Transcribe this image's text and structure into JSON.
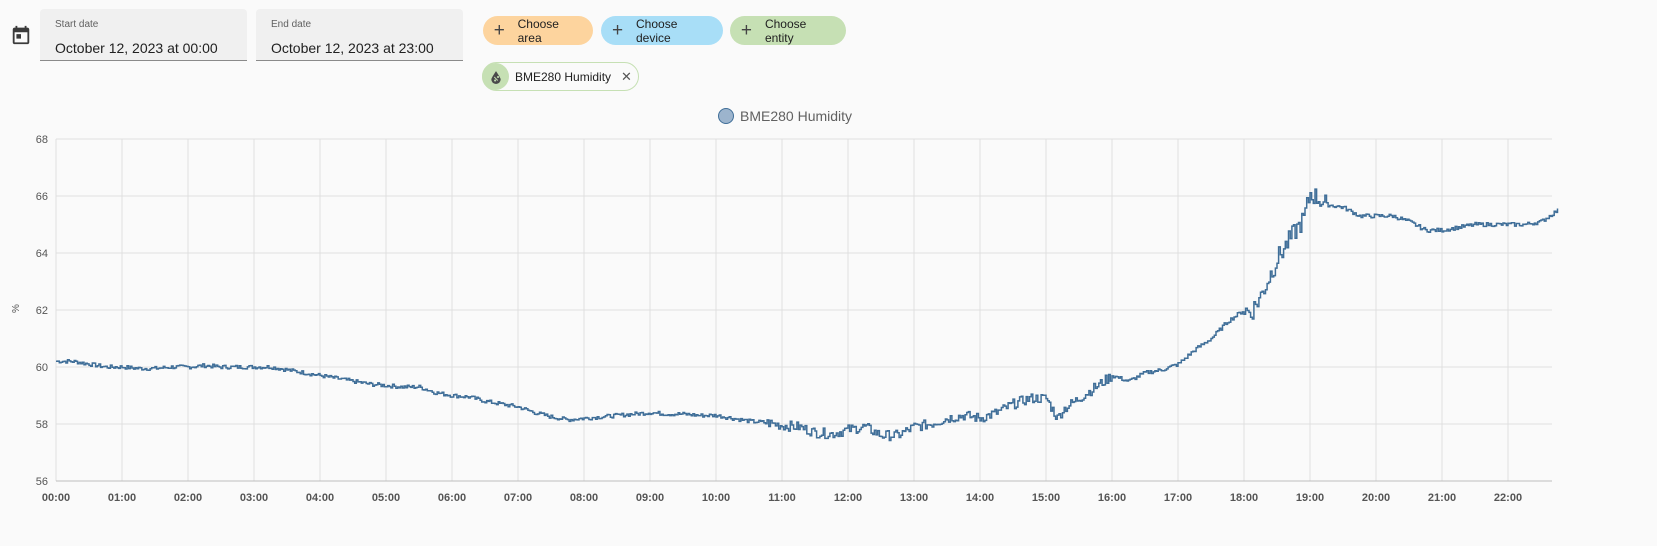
{
  "filters": {
    "start_date": {
      "label": "Start date",
      "value": "October 12, 2023 at 00:00"
    },
    "end_date": {
      "label": "End date",
      "value": "October 12, 2023 at 23:00"
    },
    "choose_area": {
      "label": "Choose area",
      "color": "#fdd49e"
    },
    "choose_device": {
      "label": "Choose device",
      "color": "#a8def7"
    },
    "choose_entity": {
      "label": "Choose entity",
      "color": "#c6e0b4"
    },
    "selected_entity": {
      "label": "BME280 Humidity",
      "icon": "water-percent-icon",
      "remove_icon": "close-icon"
    }
  },
  "icons": {
    "calendar": "calendar-icon"
  },
  "chart_data": {
    "type": "line",
    "step": true,
    "legend": {
      "position": "top-center",
      "entries": [
        "BME280 Humidity"
      ]
    },
    "ylabel": "%",
    "ylim": [
      56,
      68
    ],
    "yticks": [
      "56",
      "58",
      "60",
      "62",
      "64",
      "66",
      "68"
    ],
    "xlim": [
      0,
      22.75
    ],
    "xtick_labels": [
      "00:00",
      "01:00",
      "02:00",
      "03:00",
      "04:00",
      "05:00",
      "06:00",
      "07:00",
      "08:00",
      "09:00",
      "10:00",
      "11:00",
      "12:00",
      "13:00",
      "14:00",
      "15:00",
      "16:00",
      "17:00",
      "18:00",
      "19:00",
      "20:00",
      "21:00",
      "22:00"
    ],
    "grid": true,
    "series": [
      {
        "name": "BME280 Humidity",
        "color": "#3f6e98",
        "x": [
          0,
          0.25,
          0.5,
          0.75,
          1,
          1.25,
          1.5,
          1.75,
          2,
          2.25,
          2.5,
          2.75,
          3,
          3.25,
          3.5,
          3.75,
          4,
          4.25,
          4.5,
          4.75,
          5,
          5.25,
          5.5,
          5.75,
          6,
          6.25,
          6.5,
          6.75,
          7,
          7.25,
          7.5,
          7.75,
          8,
          8.25,
          8.5,
          8.75,
          9,
          9.25,
          9.5,
          9.75,
          10,
          10.25,
          10.5,
          10.75,
          11,
          11.25,
          11.5,
          11.75,
          12,
          12.25,
          12.5,
          12.75,
          13,
          13.25,
          13.5,
          13.75,
          14,
          14.25,
          14.5,
          14.75,
          15,
          15.17,
          15.25,
          15.5,
          15.75,
          16,
          16.25,
          16.5,
          16.75,
          17,
          17.25,
          17.5,
          17.75,
          18,
          18.1,
          18.25,
          18.5,
          18.75,
          18.9,
          19,
          19.25,
          19.5,
          19.75,
          20,
          20.25,
          20.5,
          20.75,
          21,
          21.25,
          21.5,
          21.75,
          22,
          22.25,
          22.5,
          22.75
        ],
        "y": [
          60.2,
          60.2,
          60.1,
          60,
          60,
          59.95,
          59.95,
          60,
          60,
          60.05,
          60,
          60,
          60,
          60,
          59.9,
          59.8,
          59.7,
          59.6,
          59.5,
          59.4,
          59.35,
          59.3,
          59.3,
          59.1,
          59,
          58.95,
          58.8,
          58.7,
          58.6,
          58.4,
          58.25,
          58.15,
          58.2,
          58.25,
          58.3,
          58.35,
          58.4,
          58.35,
          58.35,
          58.3,
          58.3,
          58.2,
          58.1,
          58.05,
          57.95,
          57.9,
          57.7,
          57.65,
          57.8,
          57.9,
          57.6,
          57.6,
          57.9,
          58,
          58.2,
          58.3,
          58.2,
          58.4,
          58.7,
          58.9,
          58.9,
          58.2,
          58.5,
          58.9,
          59.3,
          59.7,
          59.5,
          59.8,
          59.9,
          60.1,
          60.6,
          61,
          61.6,
          62,
          61.9,
          62.5,
          63.8,
          64.7,
          65.2,
          66.1,
          65.7,
          65.6,
          65.3,
          65.3,
          65.3,
          65.1,
          64.8,
          64.8,
          64.9,
          65,
          65,
          65,
          65,
          65.1,
          65.5
        ]
      }
    ]
  }
}
